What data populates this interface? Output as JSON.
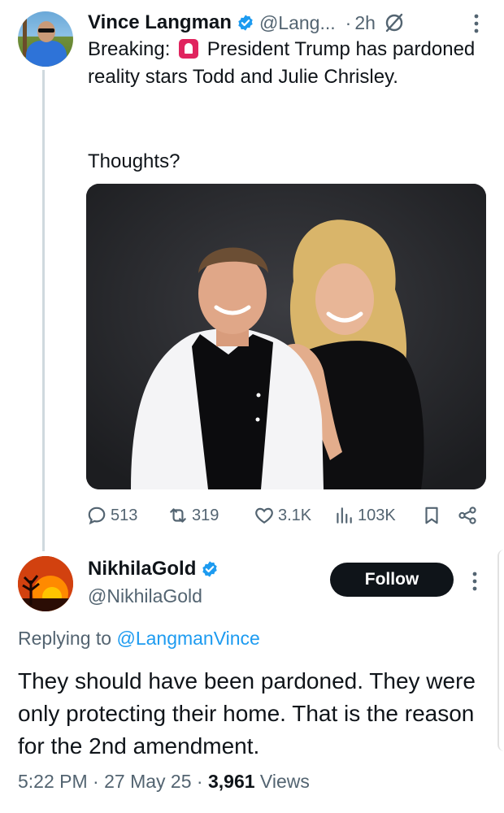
{
  "tweet": {
    "author_name": "Vince Langman",
    "author_handle": "@Lang...",
    "separator": "·",
    "time": "2h",
    "text_before_emoji": "Breaking: ",
    "text_after_emoji": " President Trump has pardoned reality stars Todd and Julie Chrisley.",
    "text_second": "Thoughts?",
    "metrics": {
      "replies": "513",
      "reposts": "319",
      "likes": "3.1K",
      "views": "103K"
    }
  },
  "reply": {
    "author_name": "NikhilaGold",
    "author_handle": "@NikhilaGold",
    "follow_label": "Follow",
    "replying_prefix": "Replying to ",
    "replying_handle": "@LangmanVince",
    "text": "They should have been pardoned. They were only protecting their home. That is the reason for the 2nd amendment.",
    "time": "5:22 PM",
    "separator": "·",
    "date": "27 May 25",
    "views_count": "3,961",
    "views_label": "Views"
  },
  "icons": {
    "verified": "verified-badge-icon",
    "grok": "grok-icon",
    "more": "more-vertical-icon",
    "reply": "reply-icon",
    "repost": "repost-icon",
    "like": "like-icon",
    "views": "views-icon",
    "bookmark": "bookmark-icon",
    "share": "share-icon",
    "siren": "police-siren-emoji"
  },
  "colors": {
    "accent": "#1d9bf0",
    "text": "#0f1419",
    "secondary": "#536471",
    "follow_bg": "#0f1419"
  }
}
